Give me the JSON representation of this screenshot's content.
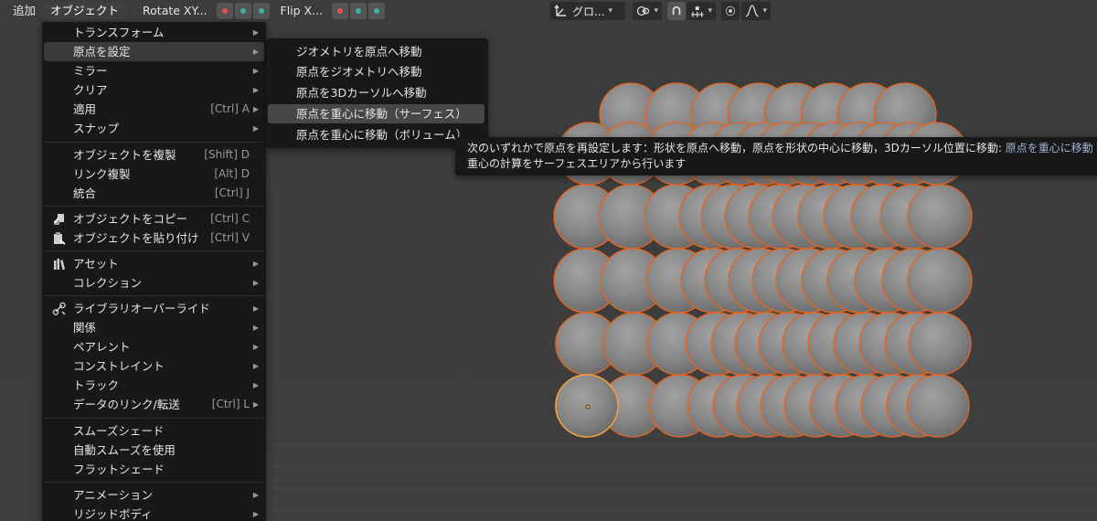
{
  "header": {
    "add_label": "追加",
    "object_label": "オブジェクト",
    "rotate_label": "Rotate XY...",
    "flip_label": "Flip X...",
    "orientation_label": "グロ..."
  },
  "main_menu": {
    "transform": "トランスフォーム",
    "set_origin": "原点を設定",
    "mirror": "ミラー",
    "clear": "クリア",
    "apply": "適用",
    "apply_shortcut": "[Ctrl] A",
    "snap": "スナップ",
    "duplicate": "オブジェクトを複製",
    "duplicate_shortcut": "[Shift] D",
    "duplicate_linked": "リンク複製",
    "duplicate_linked_shortcut": "[Alt] D",
    "join": "統合",
    "join_shortcut": "[Ctrl] J",
    "copy": "オブジェクトをコピー",
    "copy_shortcut": "[Ctrl] C",
    "paste": "オブジェクトを貼り付け",
    "paste_shortcut": "[Ctrl] V",
    "asset": "アセット",
    "collection": "コレクション",
    "library_override": "ライブラリオーバーライド",
    "relations": "関係",
    "parent": "ペアレント",
    "constraint": "コンストレイント",
    "track": "トラック",
    "link_transfer": "データのリンク/転送",
    "link_transfer_shortcut": "[Ctrl] L",
    "shade_smooth": "スムーズシェード",
    "shade_auto_smooth": "自動スムーズを使用",
    "shade_flat": "フラットシェード",
    "animation": "アニメーション",
    "rigid_body": "リジッドボディ"
  },
  "sub_menu": {
    "geometry_to_origin": "ジオメトリを原点へ移動",
    "origin_to_geometry": "原点をジオメトリへ移動",
    "origin_to_cursor": "原点を3Dカーソルへ移動",
    "origin_to_com_surface": "原点を重心に移動（サーフェス）",
    "origin_to_com_volume": "原点を重心に移動（ボリューム）"
  },
  "tooltip": {
    "line1": "次のいずれかで原点を再設定します：形状を原点へ移動，原点を形状の中心に移動，3Dカーソル位置に移動: ",
    "line1_highlight": "原点を重心に移動（",
    "line2": "重心の計算をサーフェスエリアから行います"
  },
  "colors": {
    "menu_bg": "#181818",
    "viewport_bg": "#3d3d3d",
    "selection_orange": "#e8641e",
    "active_outline": "#f0a040",
    "axis_x": "#e05050",
    "axis_yz": "#40b0a0"
  }
}
